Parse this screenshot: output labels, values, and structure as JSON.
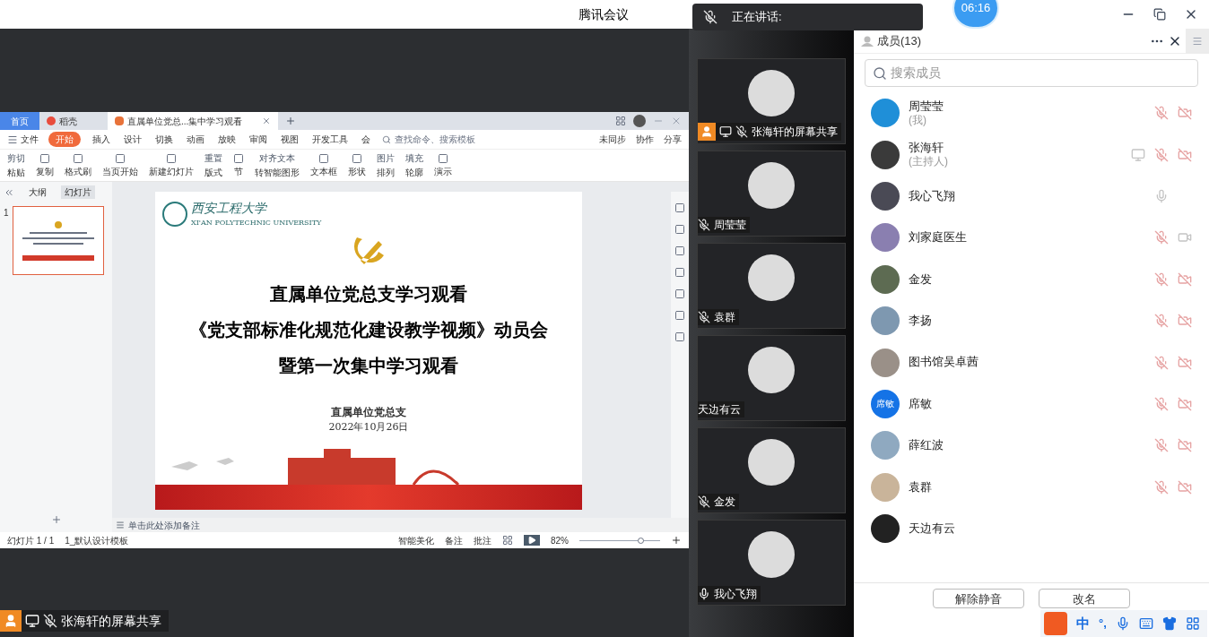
{
  "window": {
    "title": "腾讯会议",
    "timer": "06:16"
  },
  "speaking": {
    "label": "正在讲话:"
  },
  "shared_screen": {
    "tabs": [
      {
        "label": "首页",
        "kind": "home",
        "selected": false
      },
      {
        "label": "稻壳",
        "kind": "docer",
        "selected": false
      },
      {
        "label": "直属单位党总...集中学习观看",
        "kind": "doc",
        "selected": true
      }
    ],
    "menu": {
      "file": "文件",
      "tabs": [
        {
          "label": "开始",
          "selected": true
        },
        {
          "label": "插入",
          "selected": false
        },
        {
          "label": "设计",
          "selected": false
        },
        {
          "label": "切换",
          "selected": false
        },
        {
          "label": "动画",
          "selected": false
        },
        {
          "label": "放映",
          "selected": false
        },
        {
          "label": "审阅",
          "selected": false
        },
        {
          "label": "视图",
          "selected": false
        },
        {
          "label": "开发工具",
          "selected": false
        },
        {
          "label": "会",
          "selected": false
        }
      ],
      "search": "查找命令、搜索模板",
      "sync": "未同步",
      "collab": "协作",
      "share": "分享"
    },
    "ribbon": [
      {
        "top": "剪切",
        "bottom": "粘贴"
      },
      {
        "bottom": "复制"
      },
      {
        "bottom": "格式刷"
      },
      {
        "bottom": "当页开始"
      },
      {
        "bottom": "新建幻灯片"
      },
      {
        "top": "重置",
        "bottom": "版式"
      },
      {
        "bottom": "节"
      },
      {
        "top": "对齐文本",
        "bottom": "转智能图形"
      },
      {
        "bottom": "文本框"
      },
      {
        "bottom": "形状"
      },
      {
        "top": "图片",
        "bottom": "排列"
      },
      {
        "top": "填充",
        "bottom": "轮廓"
      },
      {
        "bottom": "演示"
      }
    ],
    "side_tabs": [
      {
        "label": "大纲",
        "selected": false
      },
      {
        "label": "幻灯片",
        "selected": true
      }
    ],
    "slide_number": "1",
    "slide": {
      "school": "西安工程大学",
      "school_en": "XI'AN POLYTECHNIC UNIVERSITY",
      "title_lines": [
        "直属单位党总支学习观看",
        "《党支部标准化规范化建设教学视频》动员会",
        "暨第一次集中学习观看"
      ],
      "org": "直属单位党总支",
      "date": "2022年10月26日"
    },
    "notes_placeholder": "单击此处添加备注",
    "status_bar": {
      "slide_count": "幻灯片 1 / 1",
      "template": "1_默认设计模板",
      "beautify": "智能美化",
      "notes": "备注",
      "comments": "批注",
      "zoom": "82%",
      "level": 0.75
    }
  },
  "share_label": {
    "name": "张海轩的屏幕共享",
    "muted": true
  },
  "video_tiles": [
    {
      "name": "张海轩的屏幕共享",
      "sharing": true,
      "mic": {
        "muted": true
      }
    },
    {
      "name": "周莹莹",
      "sharing": false,
      "mic": {
        "muted": true
      }
    },
    {
      "name": "袁群",
      "sharing": false,
      "mic": {
        "muted": true
      }
    },
    {
      "name": "天边有云",
      "sharing": false
    },
    {
      "name": "金发",
      "sharing": false,
      "mic": {
        "muted": true
      }
    },
    {
      "name": "我心飞翔",
      "sharing": false,
      "mic": {
        "muted": false
      }
    }
  ],
  "members_panel": {
    "title": "成员(13)",
    "search": {
      "placeholder": "搜索成员"
    },
    "members": [
      {
        "name": "周莹莹",
        "role": "(我)",
        "color": "#1f8fd8",
        "sharing": false,
        "mic": {
          "muted": true
        },
        "camera": {
          "off": true
        }
      },
      {
        "name": "张海轩",
        "role": "(主持人)",
        "color": "#3a3a3a",
        "sharing": true,
        "mic": {
          "muted": true
        },
        "camera": {
          "off": true
        }
      },
      {
        "name": "我心飞翔",
        "color": "#4a4a55",
        "sharing": false,
        "mic": {
          "muted": false
        }
      },
      {
        "name": "刘家庭医生",
        "color": "#8a7fb0",
        "sharing": false,
        "mic": {
          "muted": true
        },
        "camera": {
          "off": false
        }
      },
      {
        "name": "金发",
        "color": "#5d6b52",
        "sharing": false,
        "mic": {
          "muted": true
        },
        "camera": {
          "off": true
        }
      },
      {
        "name": "李扬",
        "color": "#7e98b0",
        "sharing": false,
        "mic": {
          "muted": true
        },
        "camera": {
          "off": true
        }
      },
      {
        "name": "图书馆吴卓茜",
        "color": "#9a9088",
        "sharing": false,
        "mic": {
          "muted": true
        },
        "camera": {
          "off": true
        }
      },
      {
        "name": "席敏",
        "avatar_text": "席敏",
        "color": "#1573e6",
        "sharing": false,
        "mic": {
          "muted": true
        },
        "camera": {
          "off": true
        }
      },
      {
        "name": "薛红波",
        "color": "#8fa9c0",
        "sharing": false,
        "mic": {
          "muted": true
        },
        "camera": {
          "off": true
        }
      },
      {
        "name": "袁群",
        "color": "#c9b49a",
        "sharing": false,
        "mic": {
          "muted": true
        },
        "camera": {
          "off": true
        }
      },
      {
        "name": "天边有云",
        "color": "#222222",
        "sharing": false
      }
    ],
    "buttons": [
      "解除静音",
      "改名"
    ]
  },
  "ime": {
    "mode": "中",
    "punct": "°,"
  }
}
